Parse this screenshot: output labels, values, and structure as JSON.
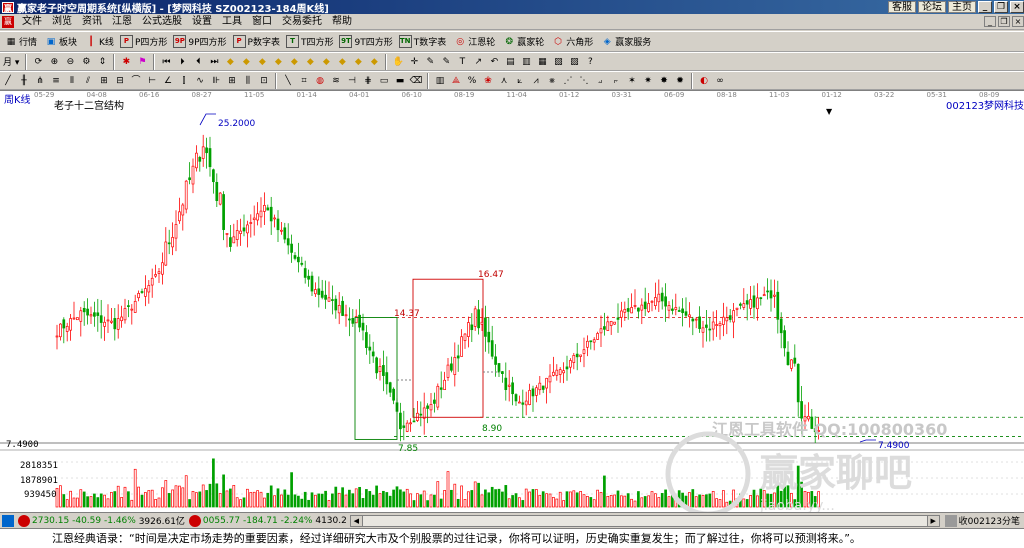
{
  "window": {
    "title": "赢家老子时空周期系统[纵横版] - [梦网科技   SZ002123-184周K线]",
    "links": [
      "客服",
      "论坛",
      "主页"
    ]
  },
  "menu": [
    "文件",
    "浏览",
    "资讯",
    "江恩",
    "公式选股",
    "设置",
    "工具",
    "窗口",
    "交易委托",
    "帮助"
  ],
  "toolbar1": [
    {
      "label": "行情",
      "icon": "grid-icon"
    },
    {
      "label": "板块",
      "icon": "blocks-icon"
    },
    {
      "label": "K线",
      "icon": "candle-icon"
    },
    {
      "label": "P四方形",
      "glyph": "P"
    },
    {
      "label": "9P四方形",
      "glyph": "9P"
    },
    {
      "label": "P数字表",
      "glyph": "P"
    },
    {
      "label": "T四方形",
      "glyph": "T"
    },
    {
      "label": "9T四方形",
      "glyph": "9T"
    },
    {
      "label": "T数字表",
      "glyph": "TN"
    },
    {
      "label": "江恩轮",
      "icon": "wheel-icon"
    },
    {
      "label": "赢家轮",
      "icon": "wheel-icon"
    },
    {
      "label": "六角形",
      "icon": "hexagon-icon"
    },
    {
      "label": "赢家服务",
      "icon": "service-icon"
    }
  ],
  "chart": {
    "period_label": "周K线",
    "structure_label": "老子十二宫结构",
    "stock_code": "002123",
    "stock_name": "梦网科技",
    "date_ticks": [
      "05-29",
      "04-08",
      "06-16",
      "08-27",
      "11-05",
      "01-14",
      "04-01",
      "06-10",
      "08-19",
      "11-04",
      "01-12",
      "03-31",
      "06-09",
      "08-18",
      "11-03",
      "01-12",
      "03-22",
      "05-31",
      "08-09"
    ],
    "high_label": "25.2000",
    "low_label": "7.4900",
    "axis_price_label": "7.4900",
    "box_labels": [
      "14.37",
      "16.47",
      "8.90",
      "7.85"
    ],
    "volume_ticks": [
      "2818351",
      "1878901",
      "939450"
    ],
    "watermark_1": "江恩工具软件  QQ:100800360",
    "watermark_2": "赢家聊吧",
    "watermark_3": "jiaoba.yy..."
  },
  "chart_data": {
    "type": "candlestick",
    "y_range": [
      7.49,
      25.2
    ],
    "volume_range": [
      0,
      3750000
    ],
    "high": 25.2,
    "low": 7.49,
    "levels": {
      "red_dashed": 14.37,
      "green_dashed_1": 8.9,
      "green_dashed_2": 7.85
    },
    "colors": {
      "up": "#ff0000",
      "down": "#00a000",
      "volume_up": "#ff0000",
      "volume_down": "#00a000"
    },
    "segments": [
      {
        "weeks": 8,
        "from": 13.5,
        "to": 14.6
      },
      {
        "weeks": 10,
        "from": 14.6,
        "to": 14.0
      },
      {
        "weeks": 12,
        "from": 14.0,
        "to": 16.5
      },
      {
        "weeks": 14,
        "from": 16.5,
        "to": 24.0
      },
      {
        "weeks": 8,
        "from": 24.0,
        "to": 18.5
      },
      {
        "weeks": 10,
        "from": 18.5,
        "to": 20.5
      },
      {
        "weeks": 14,
        "from": 20.5,
        "to": 16.0
      },
      {
        "weeks": 14,
        "from": 16.0,
        "to": 14.0
      },
      {
        "weeks": 12,
        "from": 14.0,
        "to": 8.5
      },
      {
        "weeks": 9,
        "from": 8.5,
        "to": 9.5
      },
      {
        "weeks": 13,
        "from": 9.5,
        "to": 14.5
      },
      {
        "weeks": 12,
        "from": 14.5,
        "to": 9.6
      },
      {
        "weeks": 14,
        "from": 9.6,
        "to": 11.5
      },
      {
        "weeks": 14,
        "from": 11.5,
        "to": 14.2
      },
      {
        "weeks": 14,
        "from": 14.2,
        "to": 15.4
      },
      {
        "weeks": 14,
        "from": 15.4,
        "to": 13.8
      },
      {
        "weeks": 12,
        "from": 13.8,
        "to": 15.0
      },
      {
        "weeks": 8,
        "from": 15.0,
        "to": 15.8
      },
      {
        "weeks": 8,
        "from": 15.8,
        "to": 9.5
      },
      {
        "weeks": 5,
        "from": 9.5,
        "to": 7.8
      }
    ]
  },
  "status": {
    "sh": "2730.15",
    "sh_change": "-40.59",
    "sh_pct": "-1.46%",
    "sh_amount": "3926.61亿",
    "sz": "0055.77",
    "sz_change": "-184.71",
    "sz_pct": "-2.24%",
    "sz_amount": "4130.2",
    "right": "收002123分笔"
  },
  "quote": "江恩经典语录：“时间是决定市场走势的重要因素，经过详细研究大市及个别股票的过往记录，你将可以证明，历史确实重复发生；而了解过往，你将可以预测将来。”。"
}
